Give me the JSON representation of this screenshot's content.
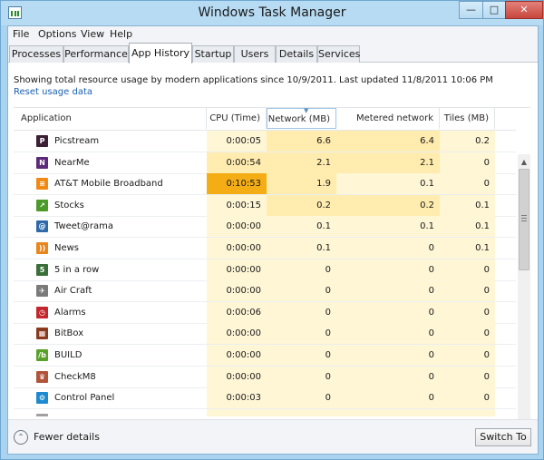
{
  "window": {
    "title": "Windows Task Manager"
  },
  "window_controls": {
    "minimize": "—",
    "maximize": "□",
    "close": "✕"
  },
  "menu": [
    "File",
    "Options",
    "View",
    "Help"
  ],
  "tabs": [
    {
      "label": "Processes",
      "active": false
    },
    {
      "label": "Performance",
      "active": false
    },
    {
      "label": "App History",
      "active": true
    },
    {
      "label": "Startup",
      "active": false
    },
    {
      "label": "Users",
      "active": false
    },
    {
      "label": "Details",
      "active": false
    },
    {
      "label": "Services",
      "active": false
    }
  ],
  "info_text": "Showing total resource usage by modern applications since 10/9/2011. Last updated 11/8/2011 10:06 PM",
  "reset_link": "Reset usage data",
  "columns": [
    {
      "key": "app",
      "label": "Application"
    },
    {
      "key": "cpu",
      "label": "CPU (Time)"
    },
    {
      "key": "network",
      "label": "Network (MB)",
      "sorted": true
    },
    {
      "key": "metered",
      "label": "Metered network (MB)"
    },
    {
      "key": "tiles",
      "label": "Tiles (MB)"
    }
  ],
  "sort_indicator": "▼",
  "rows": [
    {
      "app": "Picstream",
      "icon": "picstream-icon",
      "glyph": "P",
      "icon_color": "#3b1f35",
      "cpu": "0:00:05",
      "network": "6.6",
      "metered": "6.4",
      "tiles": "0.2",
      "heat": {
        "cpu": 0,
        "network": 1,
        "metered": 1,
        "tiles": 0
      }
    },
    {
      "app": "NearMe",
      "icon": "nearme-icon",
      "glyph": "N",
      "icon_color": "#5b2a7a",
      "cpu": "0:00:54",
      "network": "2.1",
      "metered": "2.1",
      "tiles": "0",
      "heat": {
        "cpu": 1,
        "network": 1,
        "metered": 1,
        "tiles": 0
      }
    },
    {
      "app": "AT&T Mobile Broadband",
      "icon": "att-icon",
      "glyph": "≡",
      "icon_color": "#f08a12",
      "cpu": "0:10:53",
      "network": "1.9",
      "metered": "0.1",
      "tiles": "0",
      "heat": {
        "cpu": 3,
        "network": 1,
        "metered": 0,
        "tiles": 0
      }
    },
    {
      "app": "Stocks",
      "icon": "stocks-icon",
      "glyph": "↗",
      "icon_color": "#4b9a2a",
      "cpu": "0:00:15",
      "network": "0.2",
      "metered": "0.2",
      "tiles": "0.1",
      "heat": {
        "cpu": 0,
        "network": 1,
        "metered": 1,
        "tiles": 0
      }
    },
    {
      "app": "Tweet@rama",
      "icon": "tweetarama-icon",
      "glyph": "@",
      "icon_color": "#2f6aa8",
      "cpu": "0:00:00",
      "network": "0.1",
      "metered": "0.1",
      "tiles": "0.1",
      "heat": {
        "cpu": 0,
        "network": 0,
        "metered": 0,
        "tiles": 0
      }
    },
    {
      "app": "News",
      "icon": "news-icon",
      "glyph": "))",
      "icon_color": "#e8851c",
      "cpu": "0:00:00",
      "network": "0.1",
      "metered": "0",
      "tiles": "0.1",
      "heat": {
        "cpu": 0,
        "network": 0,
        "metered": 0,
        "tiles": 0
      }
    },
    {
      "app": "5 in a row",
      "icon": "five-in-a-row-icon",
      "glyph": "5",
      "icon_color": "#3a6f3a",
      "cpu": "0:00:00",
      "network": "0",
      "metered": "0",
      "tiles": "0",
      "heat": {
        "cpu": 0,
        "network": 0,
        "metered": 0,
        "tiles": 0
      }
    },
    {
      "app": "Air Craft",
      "icon": "air-craft-icon",
      "glyph": "✈",
      "icon_color": "#7a7a7a",
      "cpu": "0:00:00",
      "network": "0",
      "metered": "0",
      "tiles": "0",
      "heat": {
        "cpu": 0,
        "network": 0,
        "metered": 0,
        "tiles": 0
      }
    },
    {
      "app": "Alarms",
      "icon": "alarms-icon",
      "glyph": "◷",
      "icon_color": "#c4262e",
      "cpu": "0:00:06",
      "network": "0",
      "metered": "0",
      "tiles": "0",
      "heat": {
        "cpu": 0,
        "network": 0,
        "metered": 0,
        "tiles": 0
      }
    },
    {
      "app": "BitBox",
      "icon": "bitbox-icon",
      "glyph": "▦",
      "icon_color": "#8a3b1e",
      "cpu": "0:00:00",
      "network": "0",
      "metered": "0",
      "tiles": "0",
      "heat": {
        "cpu": 0,
        "network": 0,
        "metered": 0,
        "tiles": 0
      }
    },
    {
      "app": "BUILD",
      "icon": "build-icon",
      "glyph": "/b",
      "icon_color": "#5aa12a",
      "cpu": "0:00:00",
      "network": "0",
      "metered": "0",
      "tiles": "0",
      "heat": {
        "cpu": 0,
        "network": 0,
        "metered": 0,
        "tiles": 0
      }
    },
    {
      "app": "CheckM8",
      "icon": "checkm8-icon",
      "glyph": "♛",
      "icon_color": "#b0553a",
      "cpu": "0:00:00",
      "network": "0",
      "metered": "0",
      "tiles": "0",
      "heat": {
        "cpu": 0,
        "network": 0,
        "metered": 0,
        "tiles": 0
      }
    },
    {
      "app": "Control Panel",
      "icon": "control-panel-icon",
      "glyph": "⚙",
      "icon_color": "#1b8ad0",
      "cpu": "0:00:03",
      "network": "0",
      "metered": "0",
      "tiles": "0",
      "heat": {
        "cpu": 0,
        "network": 0,
        "metered": 0,
        "tiles": 0
      }
    },
    {
      "app": "",
      "icon": "partial-row-icon",
      "glyph": "",
      "icon_color": "#a0a0a0",
      "cpu": "",
      "network": "",
      "metered": "",
      "tiles": "",
      "heat": {
        "cpu": 0,
        "network": 0,
        "metered": 0,
        "tiles": 0
      }
    }
  ],
  "scrollbar": {
    "up": "▲",
    "down": "▼"
  },
  "footer": {
    "fewer_icon": "⌃",
    "fewer_label": "Fewer details",
    "switch_button": "Switch To"
  }
}
